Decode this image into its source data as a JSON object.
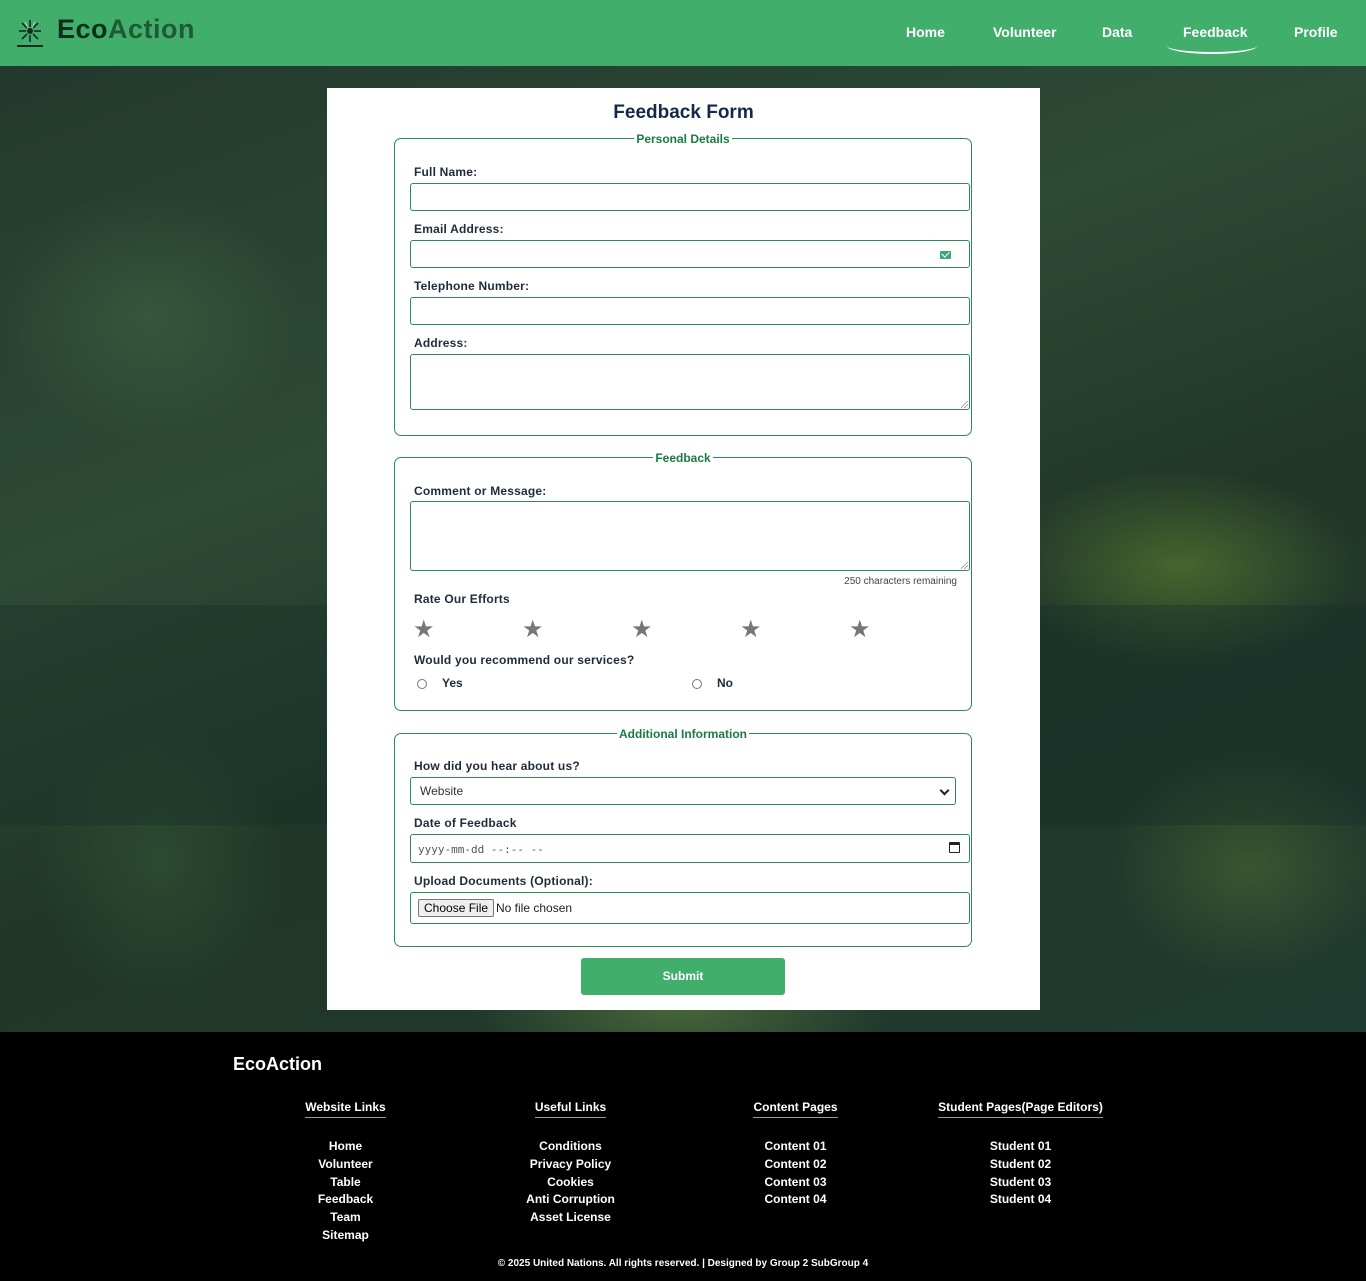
{
  "nav": {
    "brand_part1": "Eco",
    "brand_part2": "Action",
    "links": [
      "Home",
      "Volunteer",
      "Data",
      "Feedback",
      "Profile"
    ],
    "active": "Feedback",
    "accent_color": "#42ae6c"
  },
  "form": {
    "title": "Feedback Form",
    "personal": {
      "legend": "Personal Details",
      "full_name_label": "Full Name:",
      "email_label": "Email Address:",
      "phone_label": "Telephone Number:",
      "address_label": "Address:",
      "email_icon": "mail-icon"
    },
    "feedback": {
      "legend": "Feedback",
      "comment_label": "Comment or Message:",
      "chars_remaining": "250 characters remaining",
      "rate_label": "Rate Our Efforts",
      "stars": [
        "★",
        "★",
        "★",
        "★",
        "★"
      ],
      "recommend_label": "Would you recommend our services?",
      "yes_label": "Yes",
      "no_label": "No"
    },
    "additional": {
      "legend": "Additional Information",
      "hear_label": "How did you hear about us?",
      "hear_selected": "Website",
      "date_label": "Date of Feedback",
      "date_placeholder": "yyyy-mm-dd --:-- --",
      "upload_label": "Upload Documents (Optional):",
      "file_button": "Choose File",
      "file_status": "No file chosen"
    },
    "submit_label": "Submit"
  },
  "footer": {
    "brand": "EcoAction",
    "columns": [
      {
        "heading": "Website Links",
        "items": [
          "Home",
          "Volunteer",
          "Table",
          "Feedback",
          "Team",
          "Sitemap"
        ]
      },
      {
        "heading": "Useful Links",
        "items": [
          "Conditions",
          "Privacy Policy",
          "Cookies",
          "Anti Corruption",
          "Asset License"
        ]
      },
      {
        "heading": "Content Pages",
        "items": [
          "Content 01",
          "Content 02",
          "Content 03",
          "Content 04"
        ]
      },
      {
        "heading": "Student Pages(Page Editors)",
        "items": [
          "Student 01",
          "Student 02",
          "Student 03",
          "Student 04"
        ]
      }
    ],
    "copyright": "© 2025 United Nations. All rights reserved. | Designed by Group 2 SubGroup 4"
  }
}
